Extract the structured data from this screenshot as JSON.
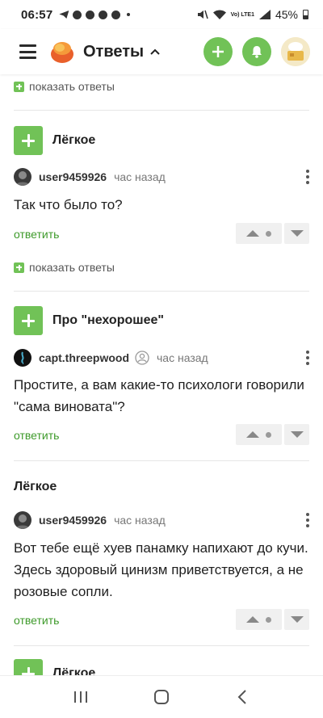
{
  "status_bar": {
    "time": "06:57",
    "battery": "45%",
    "network": "Vo) LTE1"
  },
  "header": {
    "title": "Ответы",
    "accent_color": "#71c257"
  },
  "feed": {
    "show_answers_label": "показать ответы",
    "reply_label": "ответить",
    "items": [
      {
        "title": "Лёгкое",
        "user": "user9459926",
        "time": "час назад",
        "text": "Так что было то?"
      },
      {
        "title": "Про \"нехорошее\"",
        "user": "capt.threepwood",
        "time": "час назад",
        "text": "Простите, а вам какие-то психологи говорили \"сама виновата\"?"
      },
      {
        "title": "Лёгкое",
        "user": "user9459926",
        "time": "час назад",
        "text": "Вот тебе ещё хуев панамку напихают до кучи. Здесь здоровый цинизм приветствуется, а не розовые сопли."
      },
      {
        "title": "Лёгкое"
      }
    ]
  }
}
